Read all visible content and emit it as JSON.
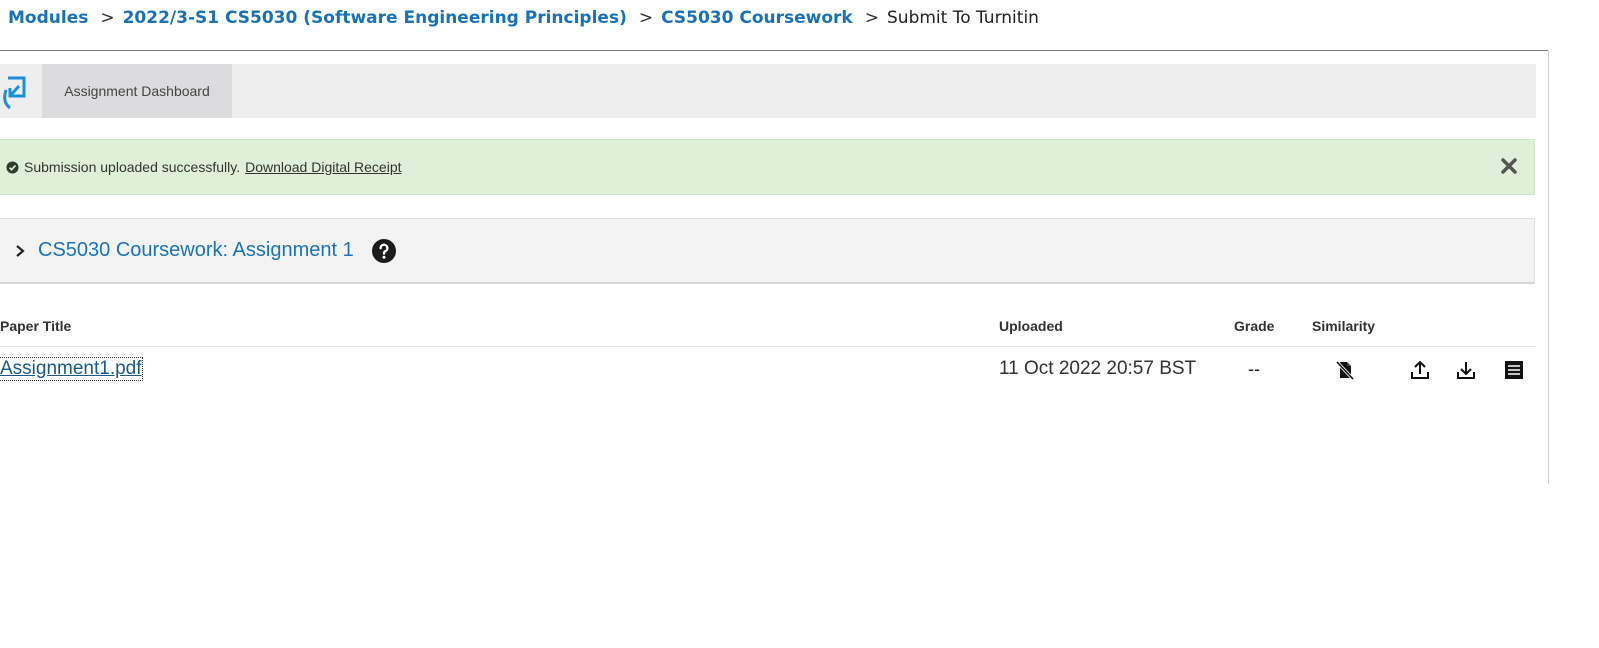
{
  "breadcrumb": {
    "modules": "Modules",
    "sep": ">",
    "module": "2022/3-S1 CS5030 (Software Engineering Principles)",
    "coursework": "CS5030 Coursework",
    "current": "Submit To Turnitin"
  },
  "toolbar": {
    "icon": "turnitin-logo-icon",
    "tab_label": "Assignment Dashboard"
  },
  "alert": {
    "message": "Submission uploaded successfully.",
    "link_label": "Download Digital Receipt",
    "color": "#dff0d8"
  },
  "assignment": {
    "title": "CS5030 Coursework: Assignment 1"
  },
  "table": {
    "headers": {
      "paper_title": "Paper Title",
      "uploaded": "Uploaded",
      "grade": "Grade",
      "similarity": "Similarity"
    },
    "rows": [
      {
        "paper_title": "Assignment1.pdf",
        "uploaded": "11 Oct 2022 20:57 BST",
        "grade": "--",
        "similarity_icon": "similarity-pending-icon"
      }
    ]
  },
  "colors": {
    "link": "#1a73b8",
    "toolbar_bg": "#eeeeef",
    "tab_bg": "#dcdcde"
  }
}
